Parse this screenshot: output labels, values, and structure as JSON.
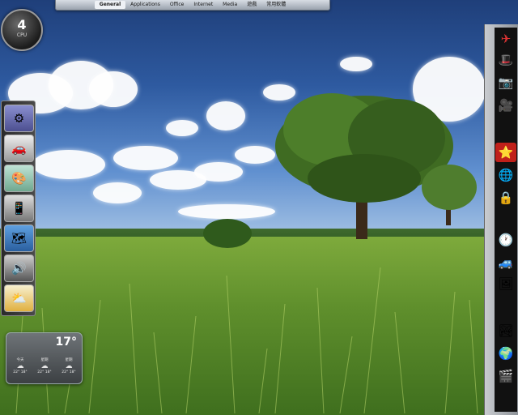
{
  "menubar": {
    "items": [
      {
        "label": "General",
        "active": true
      },
      {
        "label": "Applications",
        "active": false
      },
      {
        "label": "Office",
        "active": false
      },
      {
        "label": "Internet",
        "active": false
      },
      {
        "label": "Media",
        "active": false
      },
      {
        "label": "遊戲",
        "active": false
      },
      {
        "label": "常用軟體",
        "active": false
      }
    ]
  },
  "cpu_meter": {
    "value": "4",
    "label": "CPU"
  },
  "left_dock": {
    "items": [
      {
        "icon": "system-preferences-icon",
        "glyph": "⚙"
      },
      {
        "icon": "car-icon",
        "glyph": "🚗"
      },
      {
        "icon": "color-palette-icon",
        "glyph": "🎨"
      },
      {
        "icon": "device-icon",
        "glyph": "📱"
      },
      {
        "icon": "map-icon",
        "glyph": "🗺"
      },
      {
        "icon": "speaker-icon",
        "glyph": "🔊"
      },
      {
        "icon": "weather-icon",
        "glyph": "⛅"
      }
    ]
  },
  "weather_widget": {
    "current_temp": "17°",
    "days": [
      {
        "label": "今天",
        "high_low": "22° 18°",
        "icon": "☁"
      },
      {
        "label": "星期",
        "high_low": "22° 18°",
        "icon": "☁"
      },
      {
        "label": "星期",
        "high_low": "22° 18°",
        "icon": "☁"
      }
    ]
  },
  "right_dock": {
    "items": [
      {
        "icon": "airplane-icon",
        "glyph": "✈"
      },
      {
        "icon": "hat-icon",
        "glyph": "🎩"
      },
      {
        "icon": "camera-icon",
        "glyph": "📷"
      },
      {
        "icon": "projector-icon",
        "glyph": "🎥"
      },
      {
        "icon": "star-badge-icon",
        "glyph": "⭐"
      },
      {
        "icon": "globe-icon",
        "glyph": "🌐"
      },
      {
        "icon": "lock-icon",
        "glyph": "🔒"
      },
      {
        "icon": "clock-icon",
        "glyph": "🕐"
      },
      {
        "icon": "toy-car-icon",
        "glyph": "🚙"
      },
      {
        "icon": "picture-frame-icon",
        "glyph": "🖼"
      },
      {
        "icon": "photo-icon",
        "glyph": "🏞"
      },
      {
        "icon": "globe-2-icon",
        "glyph": "🌍"
      },
      {
        "icon": "video-star-icon",
        "glyph": "🎬"
      }
    ]
  },
  "colors": {
    "dock_dark": "#111111",
    "menubar_light": "#d8dde4"
  }
}
